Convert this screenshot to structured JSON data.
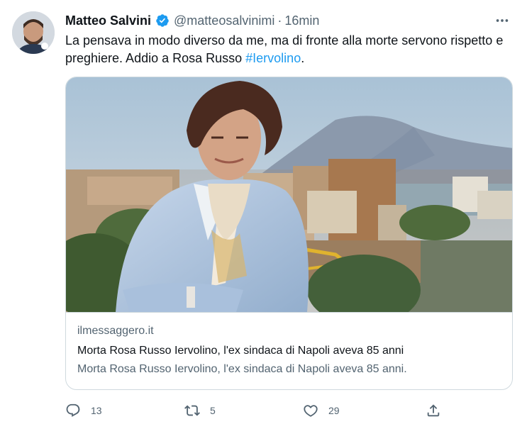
{
  "tweet": {
    "author_name": "Matteo Salvini",
    "handle": "@matteosalvinimi",
    "separator": "·",
    "time": "16min",
    "text_main": "La pensava in modo diverso da me, ma di fronte alla morte servono rispetto e preghiere. Addio a Rosa Russo ",
    "hashtag": "#Iervolino",
    "text_end": ".",
    "verified": true
  },
  "card": {
    "domain": "ilmessaggero.it",
    "title": "Morta Rosa Russo Iervolino, l'ex sindaca di Napoli aveva 85 anni",
    "description": "Morta Rosa Russo Iervolino, l'ex sindaca di Napoli aveva 85 anni."
  },
  "actions": {
    "reply_count": "13",
    "retweet_count": "5",
    "like_count": "29"
  },
  "colors": {
    "link": "#1d9bf0",
    "muted": "#536471",
    "border": "#cfd9de"
  }
}
